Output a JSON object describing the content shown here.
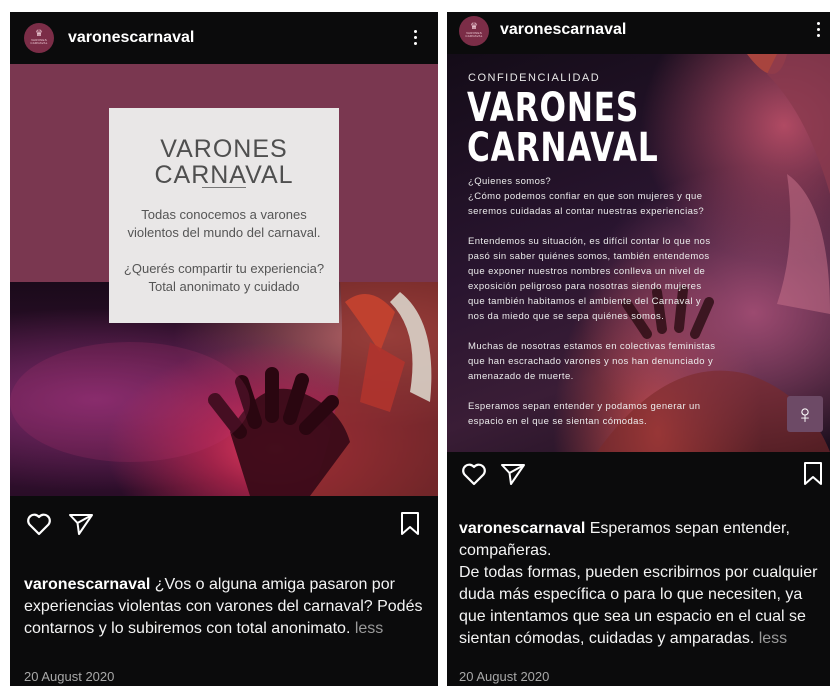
{
  "post_a": {
    "username": "varonescarnaval",
    "avatar_text": "VARONES CARNAVAL",
    "card": {
      "title_line1": "VARONES",
      "title_line2": "CARNAVAL",
      "para1_line1": "Todas conocemos a varones",
      "para1_line2": "violentos del mundo del carnaval.",
      "para2_line1": "¿Querés compartir tu experiencia?",
      "para2_line2": "Total anonimato y cuidado"
    },
    "caption": {
      "username": "varonescarnaval",
      "text": " ¿Vos o alguna amiga pasaron por experiencias violentas con varones del carnaval? Podés contarnos y lo subiremos con total anonimato.",
      "more": " less"
    },
    "date": "20 August 2020"
  },
  "post_b": {
    "username": "varonescarnaval",
    "avatar_text": "VARONES CARNAVAL",
    "image": {
      "kicker": "CONFIDENCIALIDAD",
      "title_line1": "VARONES",
      "title_line2": "CARNAVAL",
      "lines": [
        "¿Quienes somos?",
        "¿Cómo podemos confiar en que son mujeres y que",
        "seremos cuidadas al contar nuestras experiencias?",
        "",
        "Entendemos su situación, es difícil contar lo que nos",
        "pasó sin saber quiénes somos, también entendemos",
        "que exponer nuestros nombres conlleva un nivel de",
        "exposición peligroso para nosotras siendo mujeres",
        "que también habitamos el ambiente del Carnaval y",
        "nos da miedo que se sepa quiénes somos.",
        "",
        "Muchas de nosotras estamos en colectivas feministas",
        "que han escrachado varones y nos han denunciado y",
        "amenazado de muerte.",
        "",
        "Esperamos sepan entender y podamos generar un",
        "espacio en el que se sientan cómodas."
      ],
      "badge_symbol": "♀"
    },
    "caption": {
      "username": "varonescarnaval",
      "text": " Esperamos sepan entender, compañeras.",
      "text2": "De todas formas, pueden escribirnos por cualquier duda más específica o para lo que necesiten, ya que intentamos que sea un espacio en el cual se sientan cómodas, cuidadas y amparadas.",
      "more": " less"
    },
    "date": "20 August 2020"
  },
  "icons": [
    "heart-icon",
    "send-icon",
    "bookmark-icon",
    "more-options-icon",
    "venus-icon"
  ],
  "colors": {
    "card_band": "#7a3750",
    "post_bg": "#0b0b0c",
    "muted_text": "#9a9a9a"
  }
}
